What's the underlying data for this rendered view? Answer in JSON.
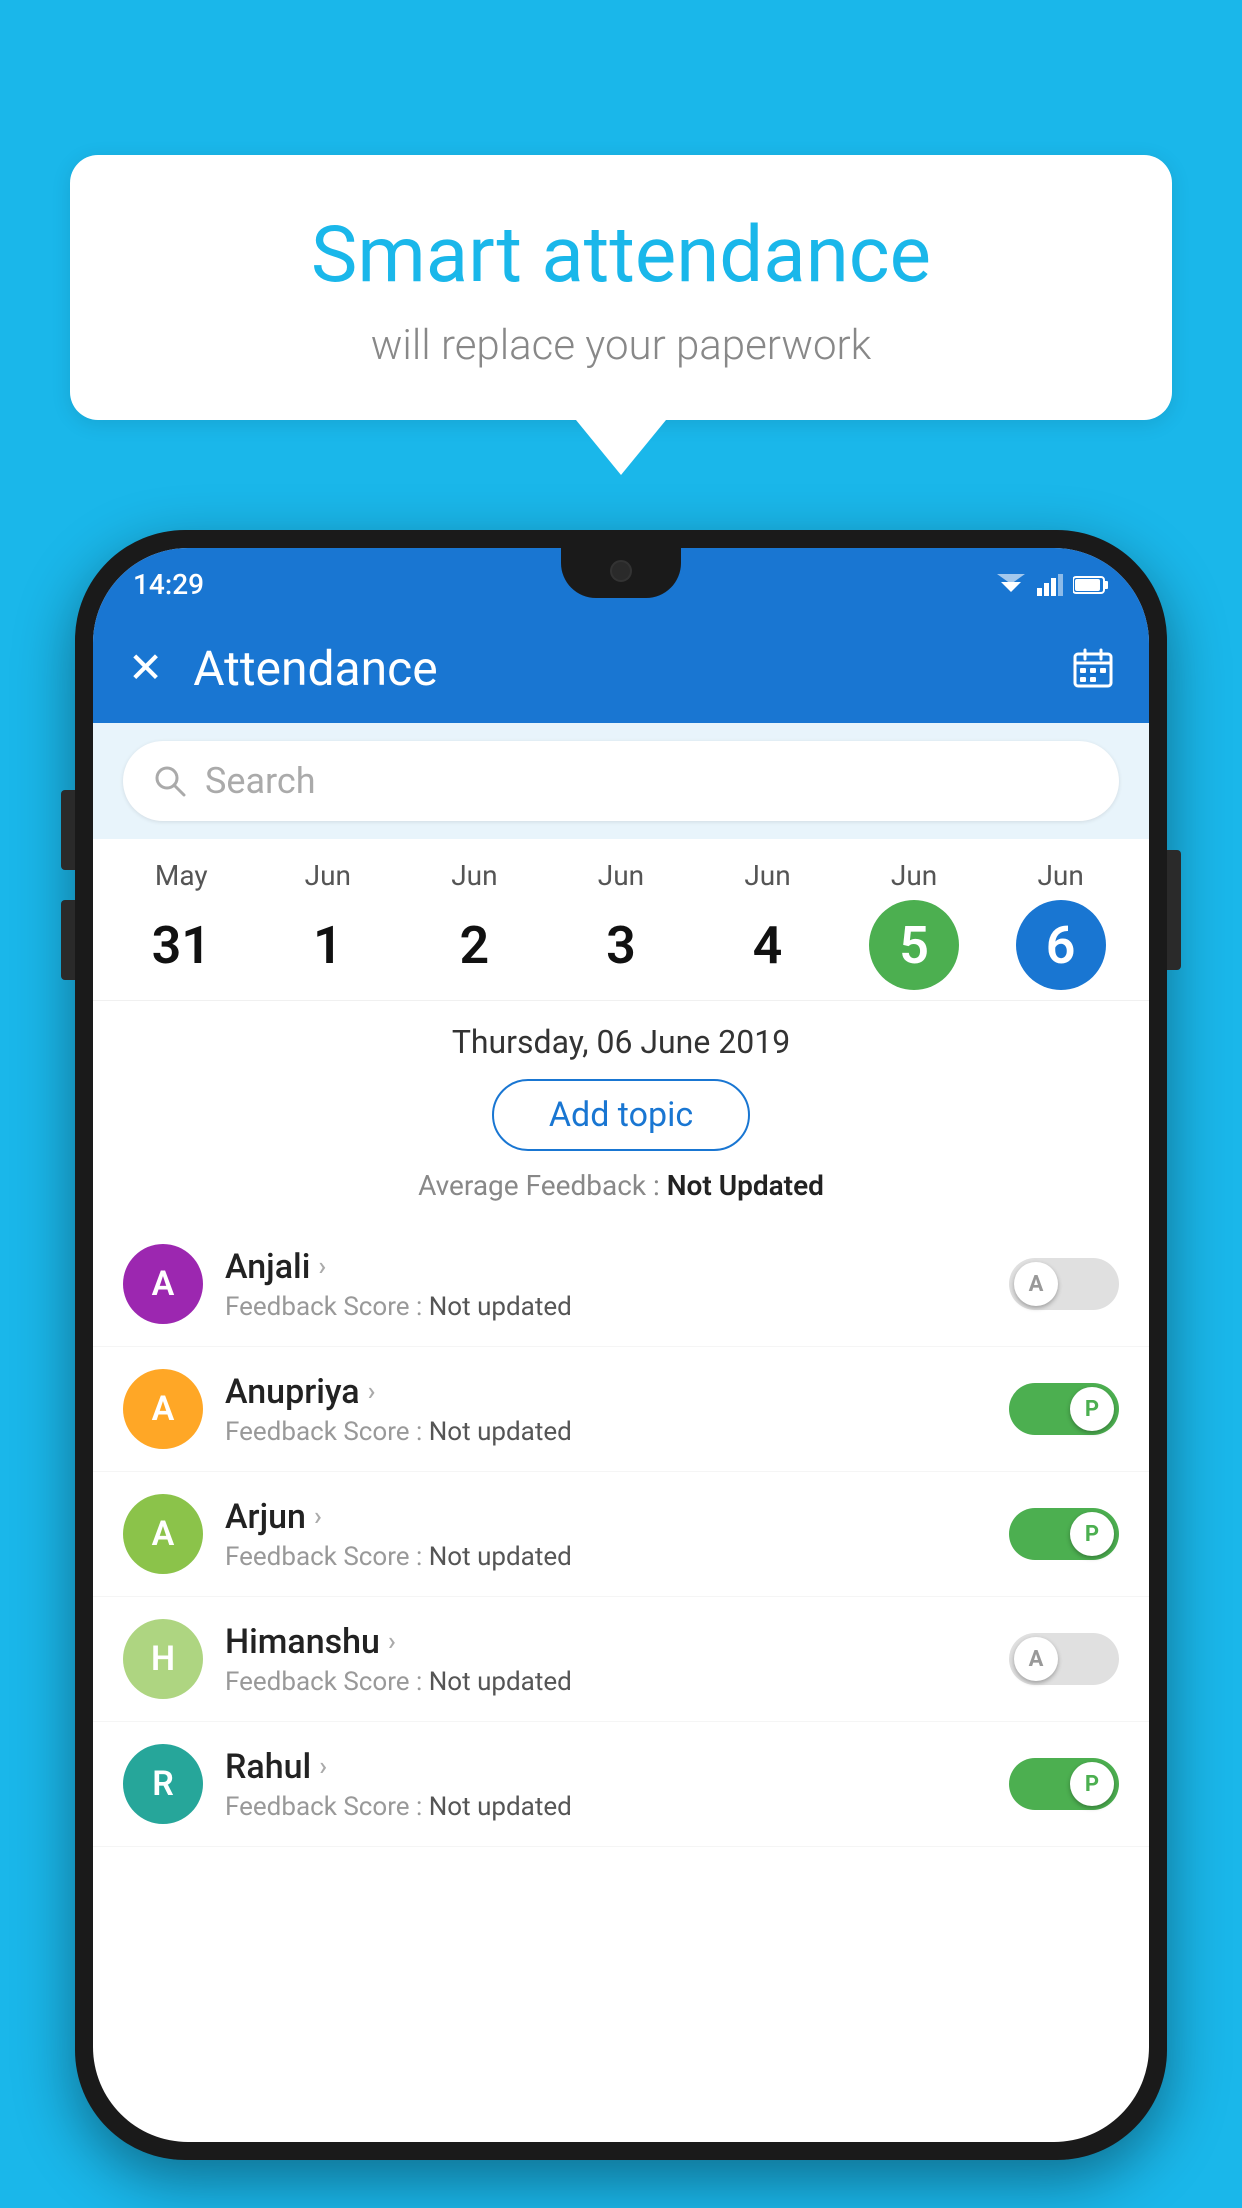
{
  "background_color": "#1ab7ea",
  "speech_bubble": {
    "title": "Smart attendance",
    "subtitle": "will replace your paperwork"
  },
  "status_bar": {
    "time": "14:29",
    "wifi_icon": "▲",
    "signal_icon": "◀",
    "battery_icon": "▐"
  },
  "app_bar": {
    "close_label": "✕",
    "title": "Attendance",
    "calendar_icon": "📅"
  },
  "search": {
    "placeholder": "Search"
  },
  "date_strip": {
    "dates": [
      {
        "month": "May",
        "day": "31",
        "style": "normal"
      },
      {
        "month": "Jun",
        "day": "1",
        "style": "normal"
      },
      {
        "month": "Jun",
        "day": "2",
        "style": "normal"
      },
      {
        "month": "Jun",
        "day": "3",
        "style": "normal"
      },
      {
        "month": "Jun",
        "day": "4",
        "style": "normal"
      },
      {
        "month": "Jun",
        "day": "5",
        "style": "today"
      },
      {
        "month": "Jun",
        "day": "6",
        "style": "selected"
      }
    ]
  },
  "selected_date": {
    "label": "Thursday, 06 June 2019",
    "add_topic_btn": "Add topic",
    "avg_feedback_label": "Average Feedback : ",
    "avg_feedback_value": "Not Updated"
  },
  "students": [
    {
      "name": "Anjali",
      "avatar_letter": "A",
      "avatar_color": "#9c27b0",
      "feedback_label": "Feedback Score : ",
      "feedback_value": "Not updated",
      "toggle": "off",
      "toggle_label": "A"
    },
    {
      "name": "Anupriya",
      "avatar_letter": "A",
      "avatar_color": "#ffa726",
      "feedback_label": "Feedback Score : ",
      "feedback_value": "Not updated",
      "toggle": "on",
      "toggle_label": "P"
    },
    {
      "name": "Arjun",
      "avatar_letter": "A",
      "avatar_color": "#8bc34a",
      "feedback_label": "Feedback Score : ",
      "feedback_value": "Not updated",
      "toggle": "on",
      "toggle_label": "P"
    },
    {
      "name": "Himanshu",
      "avatar_letter": "H",
      "avatar_color": "#aed581",
      "feedback_label": "Feedback Score : ",
      "feedback_value": "Not updated",
      "toggle": "off",
      "toggle_label": "A"
    },
    {
      "name": "Rahul",
      "avatar_letter": "R",
      "avatar_color": "#26a69a",
      "feedback_label": "Feedback Score : ",
      "feedback_value": "Not updated",
      "toggle": "on",
      "toggle_label": "P"
    }
  ]
}
